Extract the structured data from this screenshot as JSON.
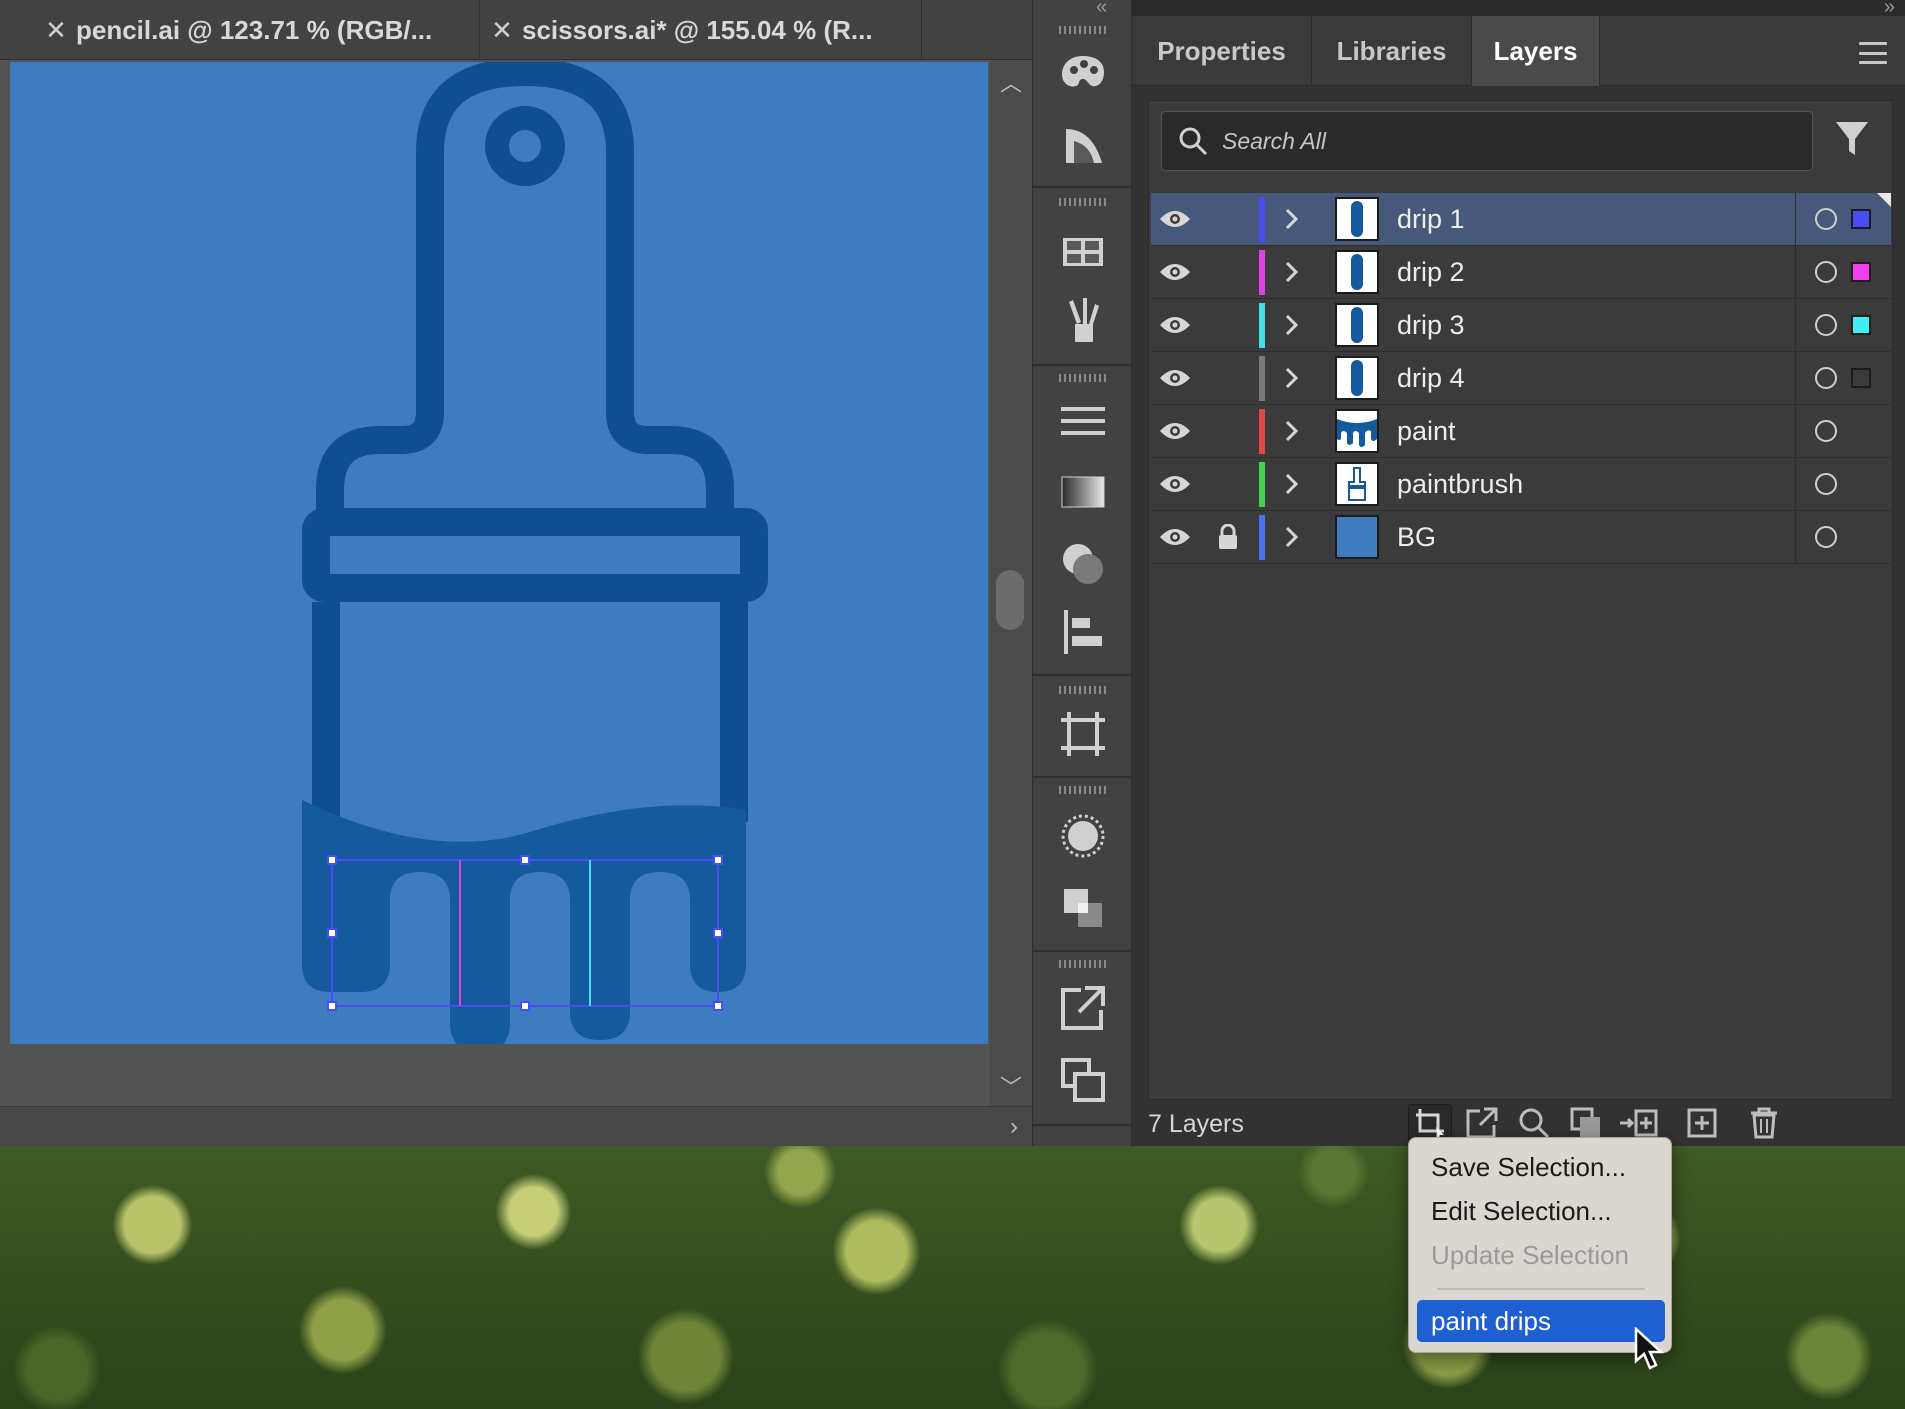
{
  "document_tabs": [
    {
      "title": "pencil.ai @ 123.71 % (RGB/...",
      "close_icon": "close-icon"
    },
    {
      "title": "scissors.ai* @ 155.04 % (R...",
      "close_icon": "close-icon"
    }
  ],
  "panel": {
    "collapse_left": "«",
    "collapse_right": "»",
    "tabs": [
      {
        "label": "Properties",
        "active": false
      },
      {
        "label": "Libraries",
        "active": false
      },
      {
        "label": "Layers",
        "active": true
      }
    ]
  },
  "search": {
    "placeholder": "Search All",
    "value": ""
  },
  "layers": [
    {
      "name": "drip 1",
      "color": "#4a4df5",
      "selected": true,
      "locked": false,
      "has_selection_square": true,
      "square_color": "#4a4df5"
    },
    {
      "name": "drip 2",
      "color": "#e53fe6",
      "selected": false,
      "locked": false,
      "has_selection_square": true,
      "square_color": "#f23ff2"
    },
    {
      "name": "drip 3",
      "color": "#3fe0e6",
      "selected": false,
      "locked": false,
      "has_selection_square": true,
      "square_color": "#3ff0f2"
    },
    {
      "name": "drip 4",
      "color": "#7a7a7a",
      "selected": false,
      "locked": false,
      "has_selection_square": true,
      "square_color": "#3a3a3a"
    },
    {
      "name": "paint",
      "color": "#e54545",
      "selected": false,
      "locked": false,
      "has_selection_square": false
    },
    {
      "name": "paintbrush",
      "color": "#3fd14a",
      "selected": false,
      "locked": false,
      "has_selection_square": false
    },
    {
      "name": "BG",
      "color": "#4a6ff2",
      "selected": false,
      "locked": true,
      "has_selection_square": false
    }
  ],
  "footer": {
    "layer_count": "7 Layers"
  },
  "context_menu": {
    "items": [
      {
        "label": "Save Selection...",
        "enabled": true
      },
      {
        "label": "Edit Selection...",
        "enabled": true
      },
      {
        "label": "Update Selection",
        "enabled": false
      }
    ],
    "saved_selection": {
      "label": "paint drips",
      "highlighted": true
    }
  },
  "colors": {
    "artboard_bg": "#3f7bbf",
    "brush_stroke": "#0f4f8f",
    "paint_fill": "#155a9c",
    "selection_box": "#4a4df5"
  }
}
